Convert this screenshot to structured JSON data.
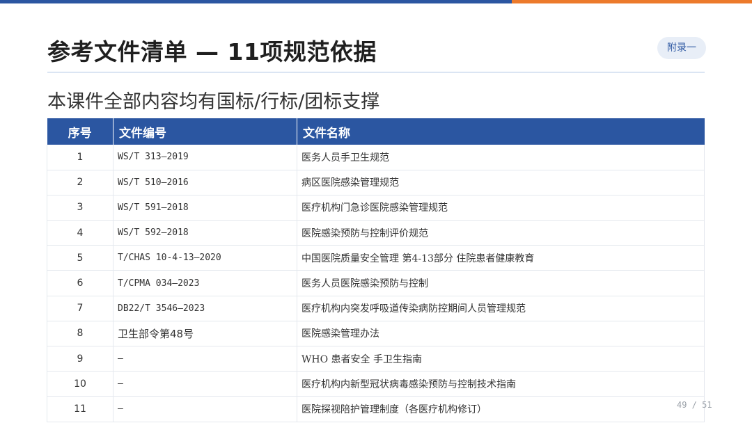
{
  "colors": {
    "primary": "#2b56a1",
    "accent": "#ec7a2b",
    "badge_bg": "#e8eef7"
  },
  "title": "参考文件清单 — 11项规范依据",
  "badge": "附录一",
  "subtitle": "本课件全部内容均有国标/行标/团标支撑",
  "table": {
    "headers": [
      "序号",
      "文件编号",
      "文件名称"
    ],
    "rows": [
      {
        "idx": "1",
        "code": "WS/T 313—2019",
        "name": "医务人员手卫生规范"
      },
      {
        "idx": "2",
        "code": "WS/T 510—2016",
        "name": "病区医院感染管理规范"
      },
      {
        "idx": "3",
        "code": "WS/T 591—2018",
        "name": "医疗机构门急诊医院感染管理规范"
      },
      {
        "idx": "4",
        "code": "WS/T 592—2018",
        "name": "医院感染预防与控制评价规范"
      },
      {
        "idx": "5",
        "code": "T/CHAS 10-4-13—2020",
        "name": "中国医院质量安全管理 第4-13部分 住院患者健康教育"
      },
      {
        "idx": "6",
        "code": "T/CPMA 034—2023",
        "name": "医务人员医院感染预防与控制"
      },
      {
        "idx": "7",
        "code": "DB22/T 3546—2023",
        "name": "医疗机构内突发呼吸道传染病防控期间人员管理规范"
      },
      {
        "idx": "8",
        "code": "卫生部令第48号",
        "name": "医院感染管理办法"
      },
      {
        "idx": "9",
        "code": "—",
        "name": "WHO 患者安全 手卫生指南"
      },
      {
        "idx": "10",
        "code": "—",
        "name": "医疗机构内新型冠状病毒感染预防与控制技术指南"
      },
      {
        "idx": "11",
        "code": "—",
        "name": "医院探视陪护管理制度（各医疗机构修订）"
      }
    ]
  },
  "page": {
    "current": "49",
    "total": "51",
    "label": "49 / 51"
  }
}
